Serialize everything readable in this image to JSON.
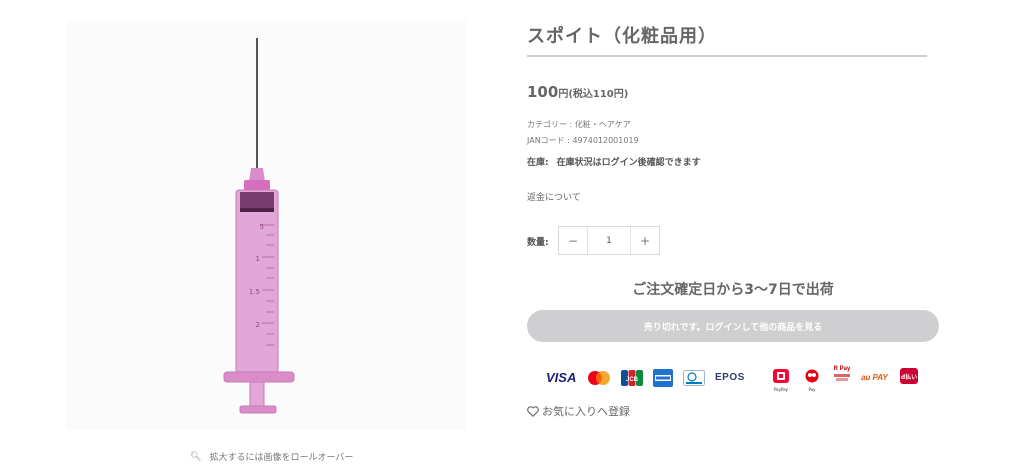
{
  "product": {
    "title": "スポイト（化粧品用）",
    "price_amount": "100",
    "price_yen": "円",
    "price_tax": "(税込110円)",
    "category": "カテゴリー : 化粧・ヘアケア",
    "jan": "JANコード : 4974012001019",
    "stock_label": "在庫:",
    "stock_text": "在庫状況はログイン後確認できます",
    "refund_link": "返金について",
    "qty_label": "数量:",
    "qty_value": "1",
    "qty_minus": "−",
    "qty_plus": "+",
    "shipping": "ご注文確定日から3〜7日で出荷",
    "soldout_button": "売り切れです。ログインして他の商品を見る",
    "favorite": "お気に入りへ登録"
  },
  "gallery": {
    "zoom_hint": "拡大するには画像をロールオーバー",
    "scale_marks": [
      "5",
      "1",
      "1.5",
      "2"
    ]
  },
  "payments": {
    "visa": "VISA",
    "epos": "EPOS",
    "paypay": "PayPay",
    "merpay": "Pay",
    "rpay": "R Pay",
    "aupay": "au PAY",
    "dbarai": "d払い"
  }
}
